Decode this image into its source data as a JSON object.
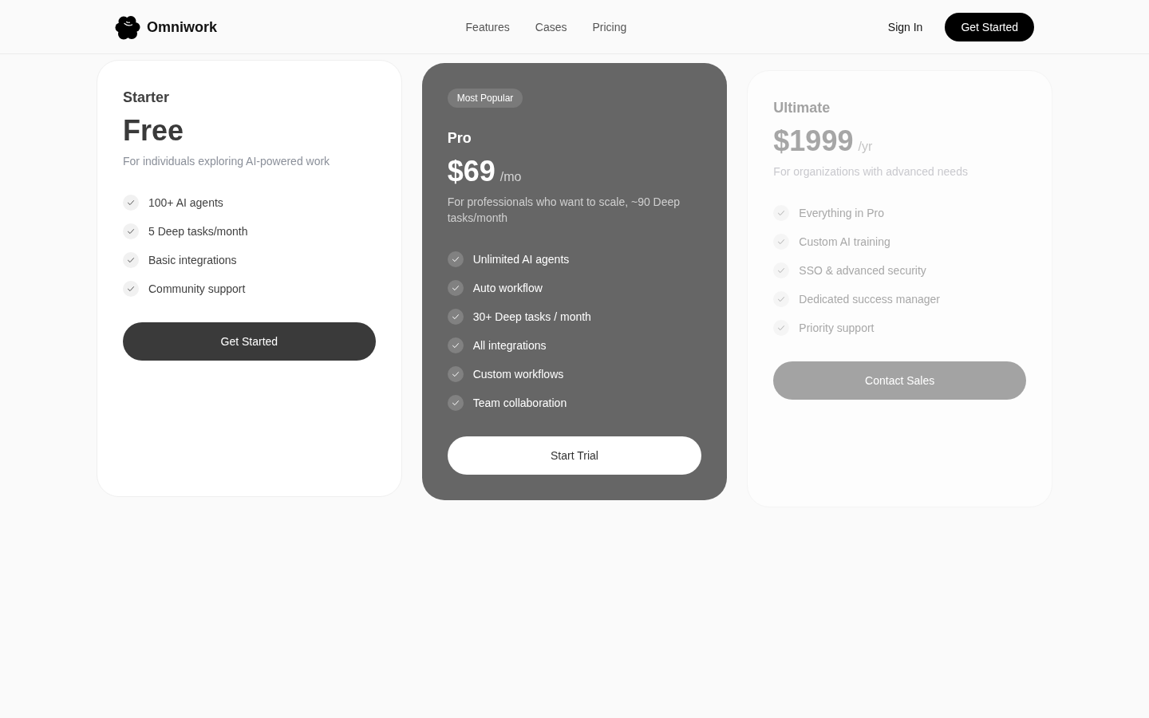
{
  "header": {
    "logo": "Omniwork",
    "links": [
      "Features",
      "Cases",
      "Pricing"
    ],
    "sign_in": "Sign In",
    "cta": "Get Started"
  },
  "plans": [
    {
      "kind": "standard",
      "name": "Starter",
      "price": "Free",
      "description": "For individuals exploring AI-powered work",
      "features": [
        "100+ AI agents",
        "5 Deep tasks/month",
        "Basic integrations",
        "Community support"
      ],
      "button": "Get Started"
    },
    {
      "kind": "featured",
      "badge": "Most Popular",
      "name": "Pro",
      "price": "$69",
      "period": "/mo",
      "description": "For professionals who want to scale, ~90 Deep tasks/month",
      "features": [
        "Unlimited AI agents",
        "Auto workflow",
        "30+ Deep tasks / month",
        "All integrations",
        "Custom workflows",
        "Team collaboration"
      ],
      "button": "Start Trial"
    },
    {
      "kind": "muted",
      "name": "Ultimate",
      "price": "$1999",
      "period": "/yr",
      "description": "For organizations with advanced needs",
      "features": [
        "Everything in Pro",
        "Custom AI training",
        "SSO & advanced security",
        "Dedicated success manager",
        "Priority support"
      ],
      "button": "Contact Sales"
    }
  ]
}
